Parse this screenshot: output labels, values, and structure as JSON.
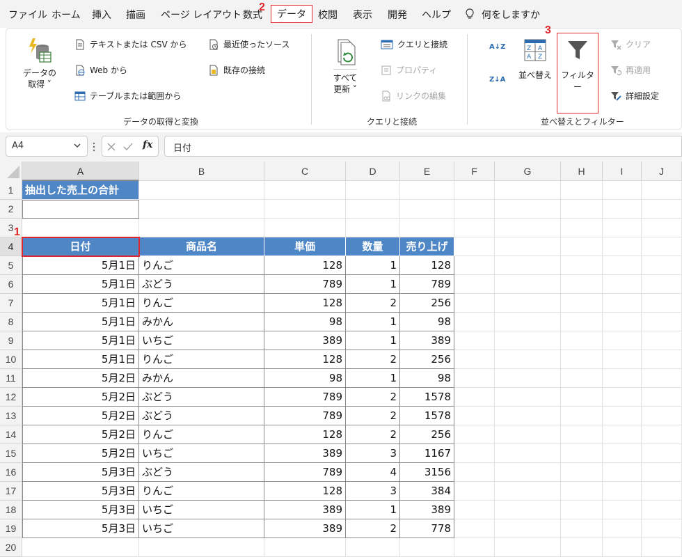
{
  "menu": {
    "items": [
      "ファイル",
      "ホーム",
      "挿入",
      "描画",
      "ページ レイアウト",
      "数式",
      "データ",
      "校閲",
      "表示",
      "開発",
      "ヘルプ"
    ],
    "tell_me": "何をしますか",
    "active_index": 6
  },
  "callouts": {
    "c1": "1",
    "c2": "2",
    "c3": "3"
  },
  "ribbon": {
    "get_data_label": "データの\n取得 ˅",
    "text_csv": "テキストまたは CSV から",
    "from_web": "Web から",
    "from_table": "テーブルまたは範囲から",
    "recent_sources": "最近使ったソース",
    "existing_connections": "既存の接続",
    "group_get_transform": "データの取得と変換",
    "refresh_all": "すべて\n更新 ˅",
    "queries_connections": "クエリと接続",
    "properties": "プロパティ",
    "edit_links": "リンクの編集",
    "group_queries": "クエリと接続",
    "sort_asc": "A↓Z",
    "sort_desc": "Z↓A",
    "sort": "並べ替え",
    "filter": "フィルター",
    "clear": "クリア",
    "reapply": "再適用",
    "advanced": "詳細設定",
    "group_sort_filter": "並べ替えとフィルター"
  },
  "formula_bar": {
    "name_box": "A4",
    "fx": "fx",
    "formula": "日付"
  },
  "sheet": {
    "columns": [
      "A",
      "B",
      "C",
      "D",
      "E",
      "F",
      "G",
      "H",
      "I",
      "J"
    ],
    "rows": [
      "1",
      "2",
      "3",
      "4",
      "5",
      "6",
      "7",
      "8",
      "9",
      "10",
      "11",
      "12",
      "13",
      "14",
      "15",
      "16",
      "17",
      "18",
      "19",
      "20"
    ],
    "title_cell": "抽出した売上の合計",
    "table_headers": [
      "日付",
      "商品名",
      "単価",
      "数量",
      "売り上げ"
    ],
    "table_rows": [
      [
        "5月1日",
        "りんご",
        "128",
        "1",
        "128"
      ],
      [
        "5月1日",
        "ぶどう",
        "789",
        "1",
        "789"
      ],
      [
        "5月1日",
        "りんご",
        "128",
        "2",
        "256"
      ],
      [
        "5月1日",
        "みかん",
        "98",
        "1",
        "98"
      ],
      [
        "5月1日",
        "いちご",
        "389",
        "1",
        "389"
      ],
      [
        "5月1日",
        "りんご",
        "128",
        "2",
        "256"
      ],
      [
        "5月2日",
        "みかん",
        "98",
        "1",
        "98"
      ],
      [
        "5月2日",
        "ぶどう",
        "789",
        "2",
        "1578"
      ],
      [
        "5月2日",
        "ぶどう",
        "789",
        "2",
        "1578"
      ],
      [
        "5月2日",
        "りんご",
        "128",
        "2",
        "256"
      ],
      [
        "5月2日",
        "いちご",
        "389",
        "3",
        "1167"
      ],
      [
        "5月3日",
        "ぶどう",
        "789",
        "4",
        "3156"
      ],
      [
        "5月3日",
        "りんご",
        "128",
        "3",
        "384"
      ],
      [
        "5月3日",
        "いちご",
        "389",
        "1",
        "389"
      ],
      [
        "5月3日",
        "いちご",
        "389",
        "2",
        "778"
      ]
    ]
  },
  "colors": {
    "accent_red": "#e0262a",
    "table_header_blue": "#4f86c6"
  }
}
